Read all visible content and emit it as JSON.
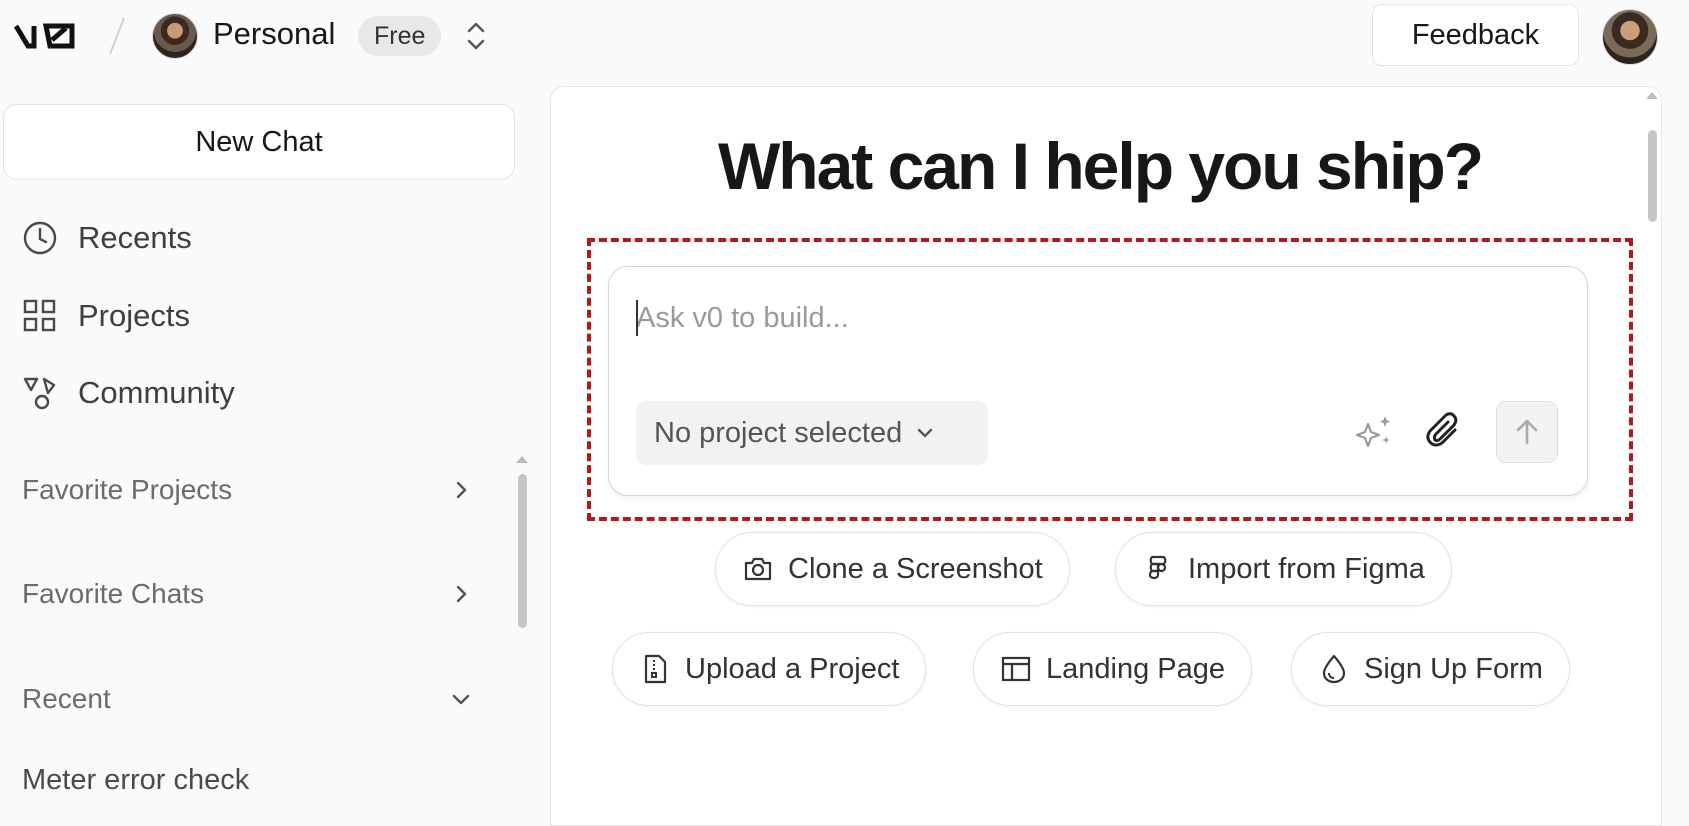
{
  "header": {
    "logo_text": "v0",
    "team_name": "Personal",
    "plan_badge": "Free",
    "feedback_label": "Feedback"
  },
  "sidebar": {
    "new_chat_label": "New Chat",
    "nav": [
      {
        "label": "Recents",
        "icon": "clock-icon"
      },
      {
        "label": "Projects",
        "icon": "grid-icon"
      },
      {
        "label": "Community",
        "icon": "shapes-icon"
      }
    ],
    "sections": [
      {
        "label": "Favorite Projects",
        "state": "collapsed"
      },
      {
        "label": "Favorite Chats",
        "state": "collapsed"
      },
      {
        "label": "Recent",
        "state": "expanded"
      }
    ],
    "recent_chats": [
      "Meter error check"
    ]
  },
  "main": {
    "headline": "What can I help you ship?",
    "prompt": {
      "placeholder": "Ask v0 to build...",
      "value": "",
      "project_select_label": "No project selected"
    },
    "quick_actions": [
      {
        "label": "Clone a Screenshot",
        "icon": "camera-icon"
      },
      {
        "label": "Import from Figma",
        "icon": "figma-icon"
      },
      {
        "label": "Upload a Project",
        "icon": "file-zip-icon"
      },
      {
        "label": "Landing Page",
        "icon": "layout-icon"
      },
      {
        "label": "Sign Up Form",
        "icon": "droplet-icon"
      }
    ]
  },
  "colors": {
    "highlight_border": "#b51818",
    "background": "#fafafa",
    "panel": "#ffffff"
  }
}
